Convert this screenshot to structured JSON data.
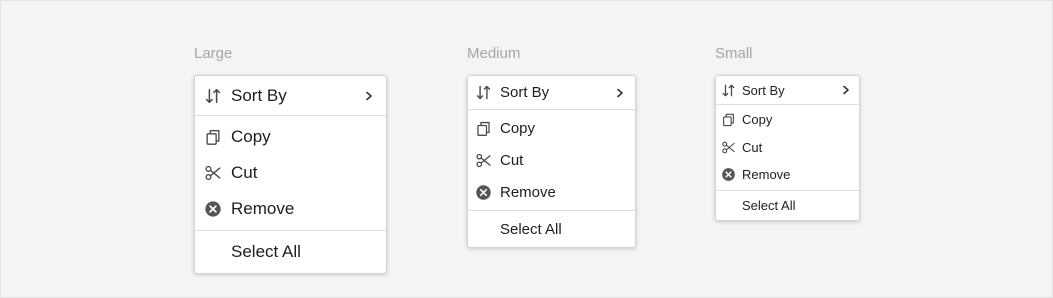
{
  "variants": [
    {
      "label": "Large",
      "menu": {
        "sort_by": "Sort By",
        "copy": "Copy",
        "cut": "Cut",
        "remove": "Remove",
        "select_all": "Select All"
      }
    },
    {
      "label": "Medium",
      "menu": {
        "sort_by": "Sort By",
        "copy": "Copy",
        "cut": "Cut",
        "remove": "Remove",
        "select_all": "Select All"
      }
    },
    {
      "label": "Small",
      "menu": {
        "sort_by": "Sort By",
        "copy": "Copy",
        "cut": "Cut",
        "remove": "Remove",
        "select_all": "Select All"
      }
    }
  ],
  "icons": {
    "sort_by": "sort-arrows-icon",
    "submenu": "chevron-right-icon",
    "copy": "copy-icon",
    "cut": "scissors-icon",
    "remove": "remove-circle-icon"
  },
  "colors": {
    "background": "#f4f4f4",
    "menu_background": "#ffffff",
    "text": "#1e1e1e",
    "icon": "#4a4a4a",
    "size_label": "#a6a6a6",
    "separator": "#dedede"
  }
}
